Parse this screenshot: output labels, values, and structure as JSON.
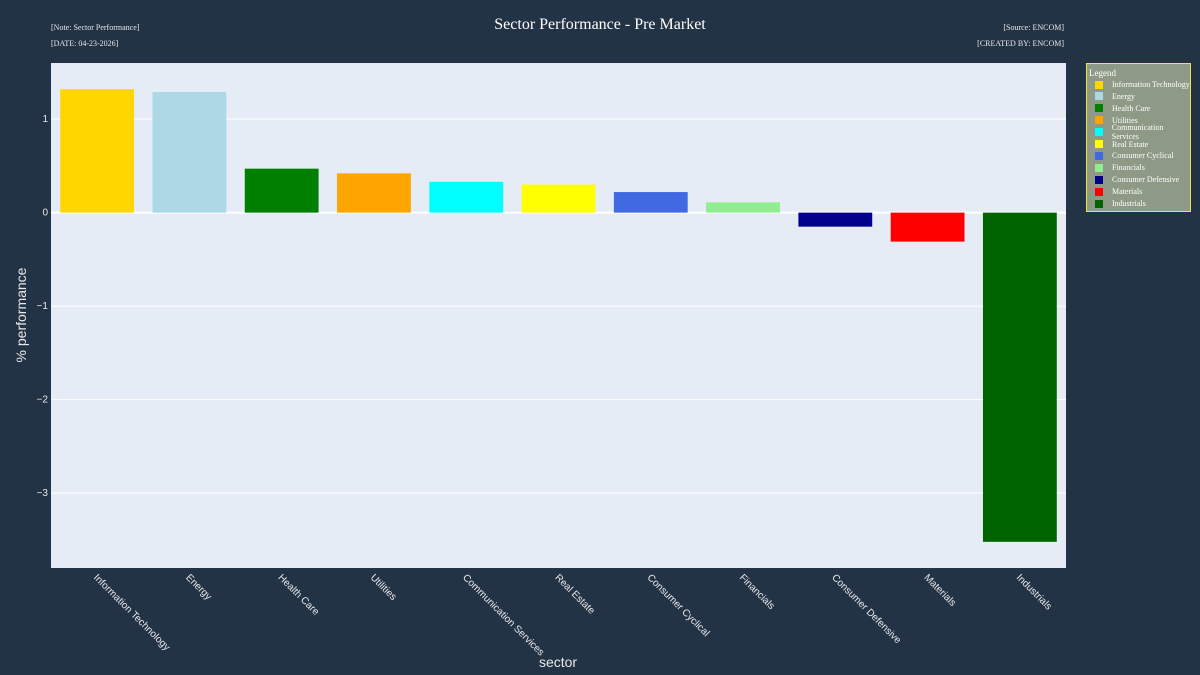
{
  "header": {
    "note": "[Note: Sector Performance]",
    "date": "[DATE: 04-23-2026]",
    "source": "[Source: ENCOM]",
    "created_by": "[CREATED BY: ENCOM]"
  },
  "colors": {
    "background": "#233346",
    "plot_bg": "#e5ecf6",
    "legend_bg": "#8e9a86",
    "legend_border": "#f2e33d"
  },
  "chart_data": {
    "type": "bar",
    "title": "Sector Performance - Pre Market",
    "xlabel": "sector",
    "ylabel": "% performance",
    "ylim": [
      -3.8,
      1.6
    ],
    "yticks": [
      1,
      0,
      -1,
      -2,
      -3
    ],
    "ytick_labels": [
      "1",
      "0",
      "−1",
      "−2",
      "−3"
    ],
    "grid": true,
    "legend_title": "Legend",
    "legend_position": "outside-top-right",
    "categories": [
      "Information Technology",
      "Energy",
      "Health Care",
      "Utilities",
      "Communication Services",
      "Real Estate",
      "Consumer Cyclical",
      "Financials",
      "Consumer Defensive",
      "Materials",
      "Industrials"
    ],
    "values": [
      1.32,
      1.29,
      0.47,
      0.42,
      0.33,
      0.3,
      0.22,
      0.11,
      -0.15,
      -0.31,
      -3.52
    ],
    "bar_colors": [
      "#ffd700",
      "#add8e6",
      "#008000",
      "#ffa500",
      "#00ffff",
      "#ffff00",
      "#4169e1",
      "#90ee90",
      "#00008b",
      "#ff0000",
      "#006400"
    ]
  }
}
